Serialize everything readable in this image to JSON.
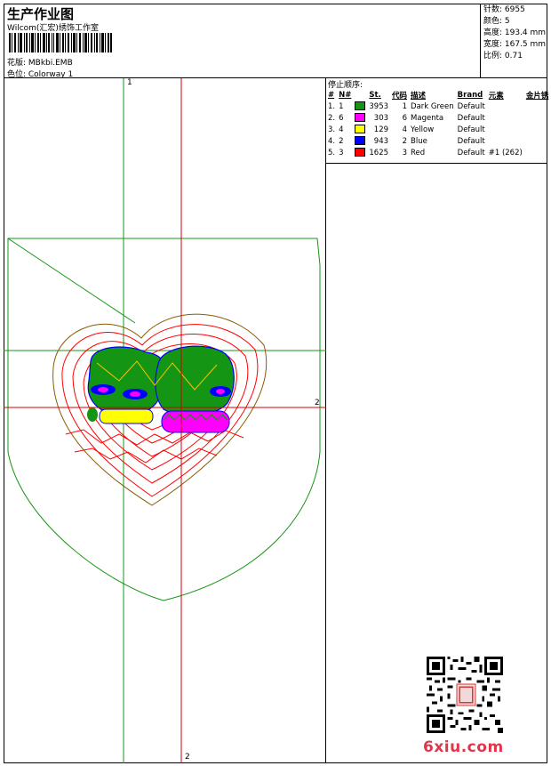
{
  "header": {
    "title": "生产作业图",
    "company": "Wilcom(汇宏)绣饰工作室",
    "design": "花版:  MBkbi.EMB",
    "colorway": "色位:  Colorway 1"
  },
  "stats": [
    "针数: 6955",
    "颜色: 5",
    "高度: 193.4 mm",
    "宽度: 167.5 mm",
    "比例: 0.71"
  ],
  "stop_sequence": {
    "title": "停止顺序:",
    "headers": [
      "#",
      "N#",
      "St.",
      "代码",
      "描述",
      "Brand",
      "元素",
      "金片锈"
    ],
    "rows": [
      {
        "idx": "1.",
        "n": "1",
        "color": "#149614",
        "st": "3953",
        "code": "1",
        "desc": "Dark Green",
        "brand": "Default",
        "elem": ""
      },
      {
        "idx": "2.",
        "n": "6",
        "color": "#ff00ff",
        "st": "303",
        "code": "6",
        "desc": "Magenta",
        "brand": "Default",
        "elem": ""
      },
      {
        "idx": "3.",
        "n": "4",
        "color": "#ffff00",
        "st": "129",
        "code": "4",
        "desc": "Yellow",
        "brand": "Default",
        "elem": ""
      },
      {
        "idx": "4.",
        "n": "2",
        "color": "#0000ff",
        "st": "943",
        "code": "2",
        "desc": "Blue",
        "brand": "Default",
        "elem": ""
      },
      {
        "idx": "5.",
        "n": "3",
        "color": "#ff0000",
        "st": "1625",
        "code": "3",
        "desc": "Red",
        "brand": "Default",
        "elem": "#1 (262)"
      }
    ]
  },
  "axis_labels": {
    "top": "1",
    "right": "2",
    "bottom": "2"
  },
  "watermark": "6xiu.com"
}
